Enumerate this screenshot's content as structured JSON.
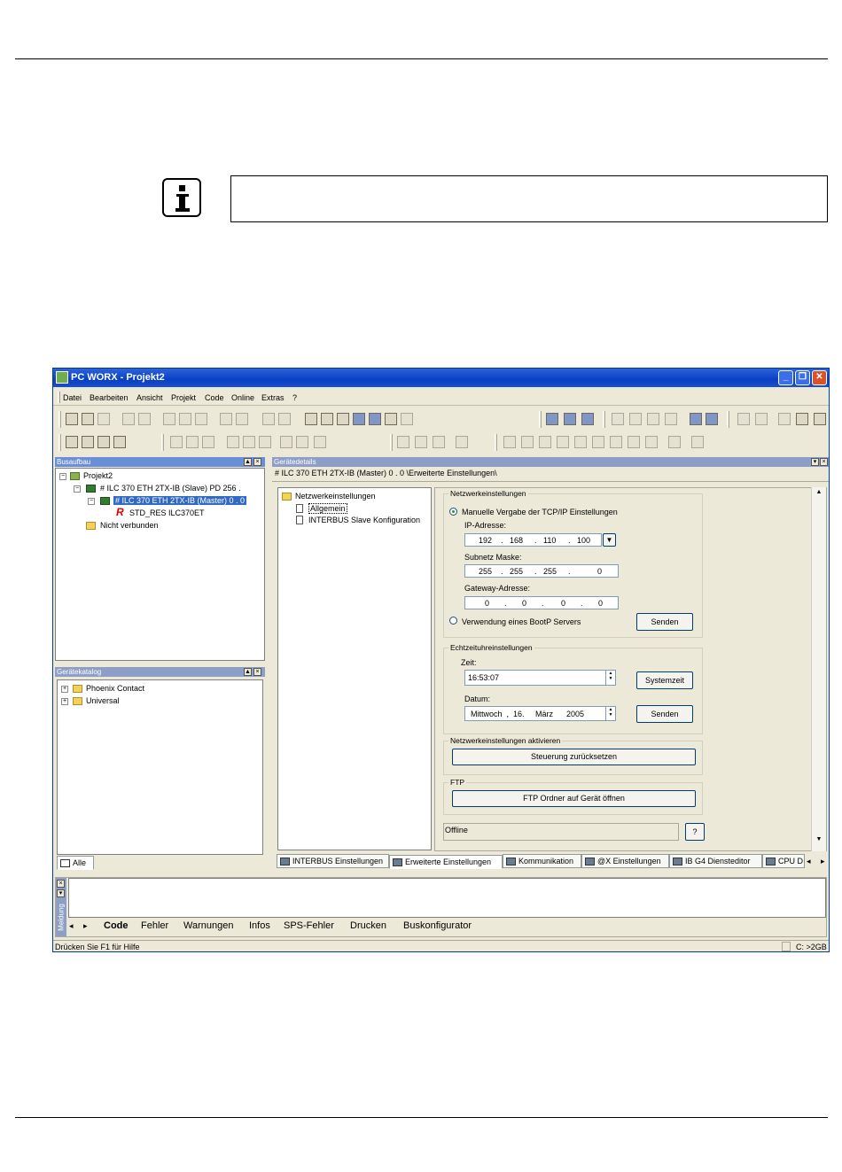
{
  "window": {
    "title": "PC WORX - Projekt2"
  },
  "menu": [
    "Datei",
    "Bearbeiten",
    "Ansicht",
    "Projekt",
    "Code",
    "Online",
    "Extras",
    "?"
  ],
  "busaufbau": {
    "title": "Busaufbau",
    "items": [
      "Projekt2",
      "# ILC 370 ETH 2TX-IB (Slave) PD 256 .",
      "# ILC 370 ETH 2TX-IB (Master) 0 . 0",
      "STD_RES ILC370ET",
      "Nicht verbunden"
    ]
  },
  "geraetekatalog": {
    "title": "Gerätekatalog",
    "items": [
      "Phoenix Contact",
      "Universal"
    ],
    "tab": "Alle"
  },
  "details": {
    "title": "Gerätedetails",
    "path": "# ILC 370 ETH 2TX-IB (Master) 0 . 0 \\Erweiterte Einstellungen\\",
    "tree": [
      "Netzwerkeinstellungen",
      "Allgemein",
      "INTERBUS Slave Konfiguration"
    ]
  },
  "network": {
    "group_label": "Netzwerkeinstellungen",
    "manual_label": "Manuelle Vergabe der TCP/IP Einstellungen",
    "ip_label": "IP-Adresse:",
    "ip": [
      "192",
      "168",
      "110",
      "100"
    ],
    "mask_label": "Subnetz Maske:",
    "mask": [
      "255",
      "255",
      "255",
      "0"
    ],
    "gateway_label": "Gateway-Adresse:",
    "gateway": [
      "0",
      "0",
      "0",
      "0"
    ],
    "bootp_label": "Verwendung eines BootP Servers",
    "send_label": "Senden"
  },
  "clock": {
    "group_label": "Echtzeituhreinstellungen",
    "time_label": "Zeit:",
    "time": "16:53:07",
    "systime_label": "Systemzeit",
    "date_label": "Datum:",
    "date": "Mittwoch  ,  16.     März      2005",
    "send_label": "Senden"
  },
  "activate": {
    "group_label": "Netzwerkeinstellungen aktivieren",
    "button": "Steuerung zurücksetzen"
  },
  "ftp": {
    "group_label": "FTP",
    "button": "FTP Ordner auf Gerät öffnen"
  },
  "status_field": "Offline",
  "help_button": "?",
  "detail_tabs": [
    "INTERBUS Einstellungen",
    "Erweiterte Einstellungen",
    "Kommunikation",
    "@X Einstellungen",
    "IB G4 Diensteditor",
    "CPU D"
  ],
  "message_side_label": "Meldung",
  "bottom_tabs": [
    "Code",
    "Fehler",
    "Warnungen",
    "Infos",
    "SPS-Fehler",
    "Drucken",
    "Buskonfigurator"
  ],
  "status": {
    "left": "Drücken Sie F1 für Hilfe",
    "right": "C: >2GB"
  }
}
